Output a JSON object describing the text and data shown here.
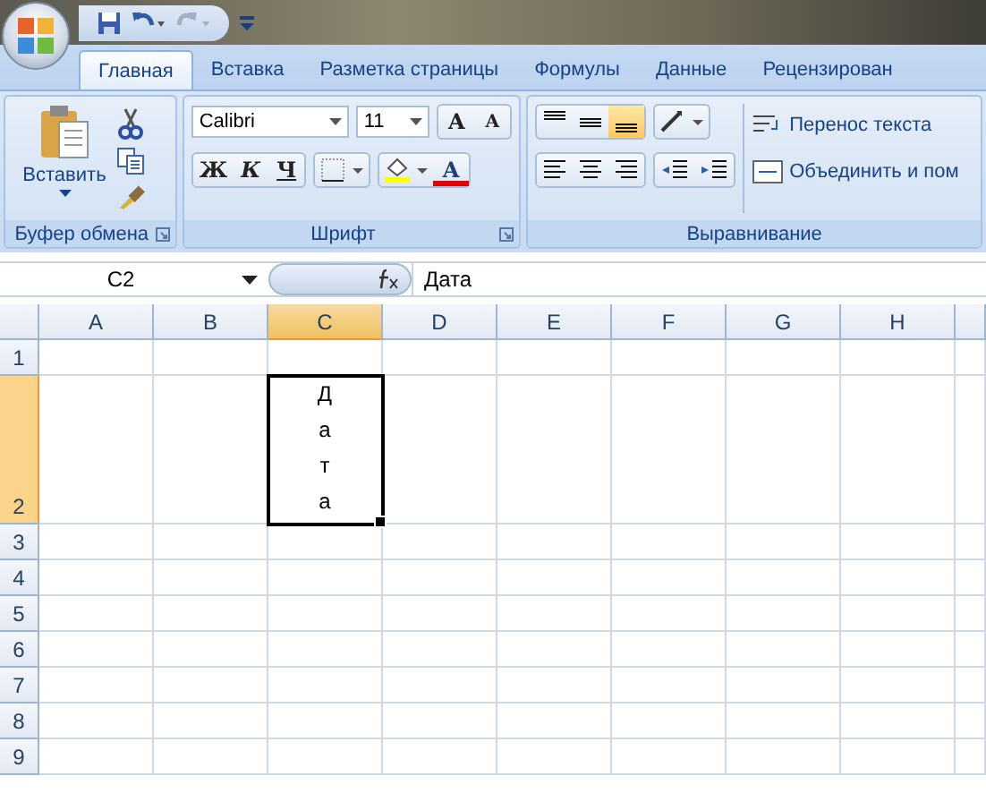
{
  "ribbon_tabs": [
    {
      "label": "Главная",
      "selected": true
    },
    {
      "label": "Вставка",
      "selected": false
    },
    {
      "label": "Разметка страницы",
      "selected": false
    },
    {
      "label": "Формулы",
      "selected": false
    },
    {
      "label": "Данные",
      "selected": false
    },
    {
      "label": "Рецензирован",
      "selected": false
    }
  ],
  "clipboard": {
    "paste": "Вставить",
    "label": "Буфер обмена"
  },
  "font": {
    "name": "Calibri",
    "size": "11",
    "grow": "A",
    "shrink": "A",
    "bold": "Ж",
    "italic": "К",
    "underline": "Ч",
    "color_letter": "A",
    "label": "Шрифт"
  },
  "alignment": {
    "vertical": [
      {
        "kind": "top",
        "selected": false
      },
      {
        "kind": "middle",
        "selected": false
      },
      {
        "kind": "bottom",
        "selected": true
      }
    ],
    "wrap_text": "Перенос текста",
    "merge": "Объединить и пом",
    "label": "Выравнивание"
  },
  "formula_bar": {
    "name_box": "C2",
    "formula": "Дата"
  },
  "columns": [
    {
      "label": "A",
      "selected": false
    },
    {
      "label": "B",
      "selected": false
    },
    {
      "label": "C",
      "selected": true
    },
    {
      "label": "D",
      "selected": false
    },
    {
      "label": "E",
      "selected": false
    },
    {
      "label": "F",
      "selected": false
    },
    {
      "label": "G",
      "selected": false
    },
    {
      "label": "H",
      "selected": false
    }
  ],
  "rows": [
    {
      "label": "1",
      "selected": false,
      "cells": []
    },
    {
      "label": "2",
      "selected": true,
      "cells": [
        null,
        null,
        {
          "value": "Дата",
          "selected": true
        }
      ]
    },
    {
      "label": "3",
      "selected": false,
      "cells": []
    },
    {
      "label": "4",
      "selected": false,
      "cells": []
    },
    {
      "label": "5",
      "selected": false,
      "cells": []
    },
    {
      "label": "6",
      "selected": false,
      "cells": []
    },
    {
      "label": "7",
      "selected": false,
      "cells": []
    },
    {
      "label": "8",
      "selected": false,
      "cells": []
    },
    {
      "label": "9",
      "selected": false,
      "cells": []
    }
  ]
}
